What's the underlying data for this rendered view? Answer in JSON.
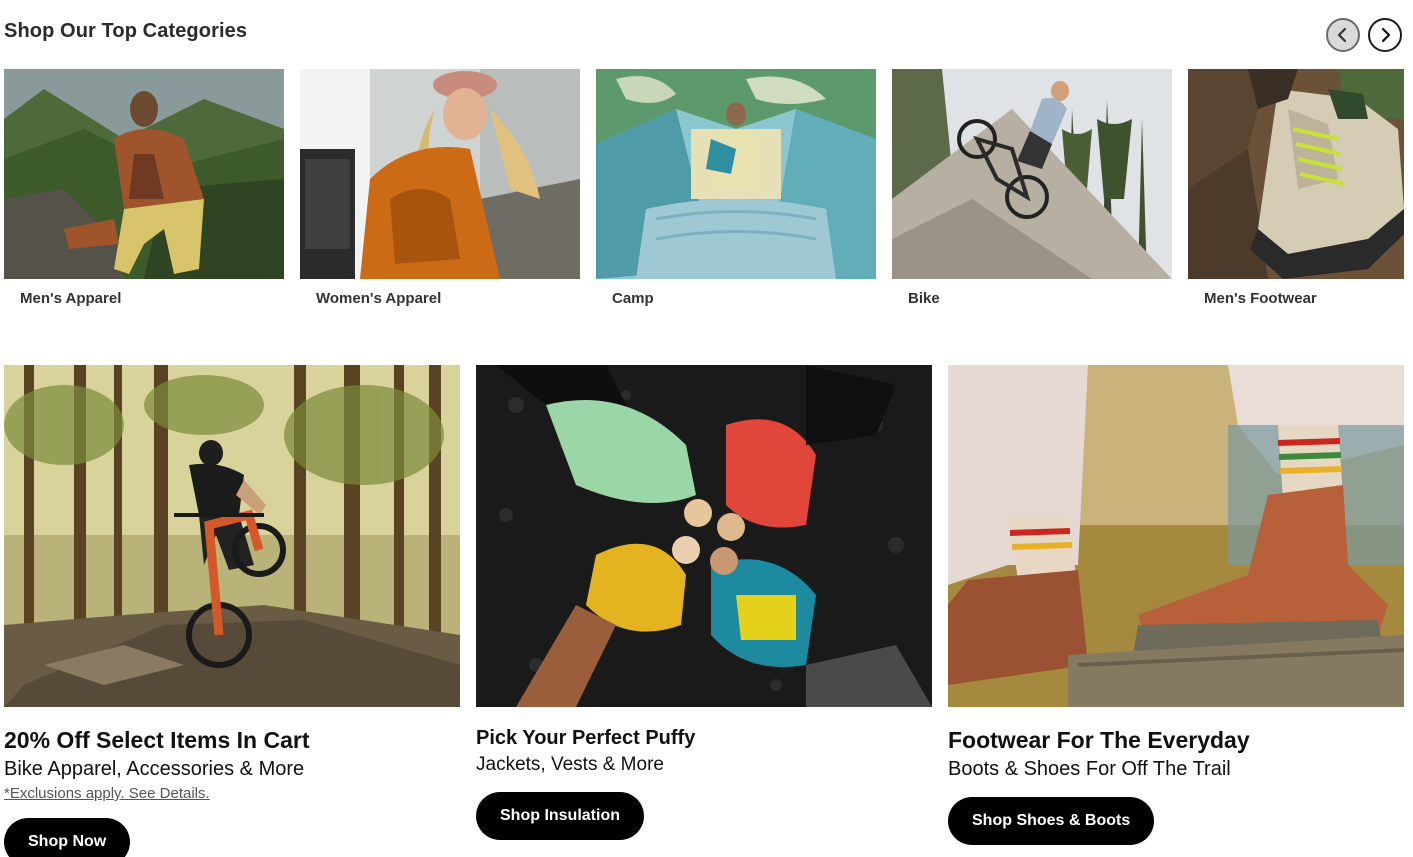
{
  "section": {
    "title": "Shop Our Top Categories",
    "prev_icon": "chevron-left-icon",
    "next_icon": "chevron-right-icon"
  },
  "categories": [
    {
      "label": "Men's Apparel"
    },
    {
      "label": "Women's Apparel"
    },
    {
      "label": "Camp"
    },
    {
      "label": "Bike"
    },
    {
      "label": "Men's Footwear"
    }
  ],
  "promos": [
    {
      "title": "20% Off Select Items In Cart",
      "subtitle": "Bike Apparel, Accessories & More",
      "note": "*Exclusions apply. See Details.",
      "button": "Shop Now"
    },
    {
      "title": "Pick Your Perfect Puffy",
      "subtitle": "Jackets, Vests & More",
      "button": "Shop Insulation"
    },
    {
      "title": "Footwear For The Everyday",
      "subtitle": "Boots & Shoes For Off The Trail",
      "button": "Shop Shoes & Boots"
    }
  ],
  "colors": {
    "button_bg": "#000000",
    "button_text": "#ffffff",
    "heading": "#2b2b2b"
  }
}
